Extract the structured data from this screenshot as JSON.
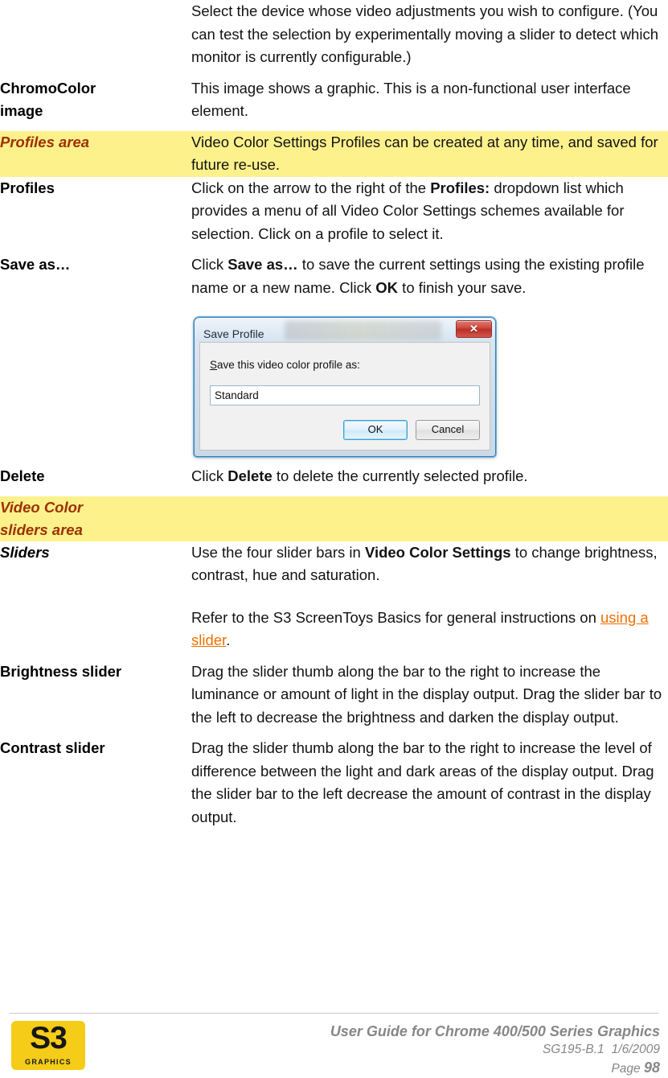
{
  "document": {
    "rows": [
      {
        "term": "",
        "term_style": "none",
        "highlight": false,
        "paragraphs": [
          "Select the device whose video adjustments you wish to configure. (You can test the selection by experimentally moving a slider to detect which monitor is currently configurable.)"
        ]
      },
      {
        "term": "ChromoColor image",
        "term_style": "bold",
        "highlight": false,
        "paragraphs": [
          "This image shows a graphic. This is a non-functional user interface element."
        ]
      },
      {
        "term": "Profiles area",
        "term_style": "area",
        "highlight": true,
        "paragraphs": [
          "Video Color Settings Profiles can be created at any time, and saved for future re-use."
        ]
      },
      {
        "term": "Profiles",
        "term_style": "bold",
        "highlight": false,
        "paragraphs": [
          "Click on the arrow to the right of the Profiles: dropdown list which provides a menu of all Video Color Settings schemes available for selection. Click on a profile to select it."
        ]
      },
      {
        "term": "Save as…",
        "term_style": "bold",
        "highlight": false,
        "paragraphs": [
          "Click Save as… to save the current settings using the existing profile name or a new name. Click OK to finish your save."
        ]
      },
      {
        "term": "Delete",
        "term_style": "bold",
        "highlight": false,
        "paragraphs": [
          "Click Delete to delete the currently selected profile."
        ]
      },
      {
        "term": "Video Color sliders area",
        "term_style": "area",
        "highlight": true,
        "paragraphs": [
          ""
        ]
      },
      {
        "term": "Sliders",
        "term_style": "bold-italic",
        "highlight": false,
        "paragraphs": [
          "Use the four slider bars in Video Color Settings to change brightness, contrast, hue and saturation.",
          "Refer to the S3 ScreenToys Basics for general instructions on using a slider."
        ]
      },
      {
        "term": "Brightness slider",
        "term_style": "bold",
        "highlight": false,
        "paragraphs": [
          "Drag the slider thumb along the bar to the right to increase the luminance or amount of light in the display output. Drag the slider bar to the left to decrease the brightness and darken the display output."
        ]
      },
      {
        "term": "Contrast slider",
        "term_style": "bold",
        "highlight": false,
        "paragraphs": [
          "Drag the slider thumb along the bar to the right to increase the level of difference between the light and dark areas of the display output. Drag the slider bar to the left decrease the amount of contrast in the display output."
        ]
      }
    ],
    "row_text": {
      "intro_full": "Select the device whose video adjustments you wish to configure. (You can test the selection by experimentally moving a slider to detect which monitor is currently configurable.)",
      "chromocolor_term_line1": "ChromoColor",
      "chromocolor_term_line2": "image",
      "chromocolor_desc": "This image shows a graphic. This is a non-functional user interface element.",
      "profiles_area_term": "Profiles area",
      "profiles_area_desc": "Video Color Settings Profiles can be created at any time, and saved for future re-use.",
      "profiles_term": "Profiles",
      "profiles_desc_a": "Click on the arrow to the right of the ",
      "profiles_desc_bold": "Profiles:",
      "profiles_desc_b": " dropdown list which provides a menu of all Video Color Settings schemes available for selection. Click on a profile to select it.",
      "saveas_term": "Save as…",
      "saveas_desc_a": "Click ",
      "saveas_desc_bold1": "Save as…",
      "saveas_desc_b": " to save the current settings using the existing profile name or a new name. Click ",
      "saveas_desc_bold2": "OK",
      "saveas_desc_c": " to finish your save.",
      "delete_term": "Delete",
      "delete_desc_a": "Click ",
      "delete_desc_bold": "Delete",
      "delete_desc_b": " to delete the currently selected profile.",
      "vcs_area_term_line1": "Video Color",
      "vcs_area_term_line2": "sliders area",
      "sliders_term": "Sliders",
      "sliders_desc_a": "Use the four slider bars in ",
      "sliders_desc_bold": "Video Color Settings",
      "sliders_desc_b": " to change brightness, contrast, hue and saturation.",
      "sliders_desc2_a": "Refer to the S3 ScreenToys Basics for general instructions on ",
      "sliders_desc2_link": "using a slider",
      "sliders_desc2_b": ".",
      "brightness_term": "Brightness slider",
      "brightness_desc": "Drag the slider thumb along the bar to the right to increase the luminance or amount of light in the display output. Drag the slider bar to the left to decrease the brightness and darken the display output.",
      "contrast_term": "Contrast slider",
      "contrast_desc": "Drag the slider thumb along the bar to the right to increase the level of difference between the light and dark areas of the display output. Drag the slider bar to the left decrease the amount of contrast in the display output."
    }
  },
  "save_profile_dialog": {
    "title": "Save Profile",
    "close_label": "✕",
    "field_label_accel": "S",
    "field_label_rest": "ave this video color profile as:",
    "input_value": "Standard",
    "input_placeholder": "",
    "ok_label": "OK",
    "cancel_label": "Cancel"
  },
  "footer": {
    "logo_text": "S3",
    "logo_subtext": "GRAPHICS",
    "line1": "User Guide for Chrome 400/500 Series Graphics",
    "doc_id": "SG195-B.1",
    "date": "1/6/2009",
    "page_label": "Page",
    "page_number": "98"
  },
  "colors": {
    "highlight_bg": "#fdf18c",
    "area_term": "#9c3100",
    "link": "#f07000",
    "footer_text": "#878787",
    "logo_yellow": "#f5cc17"
  }
}
